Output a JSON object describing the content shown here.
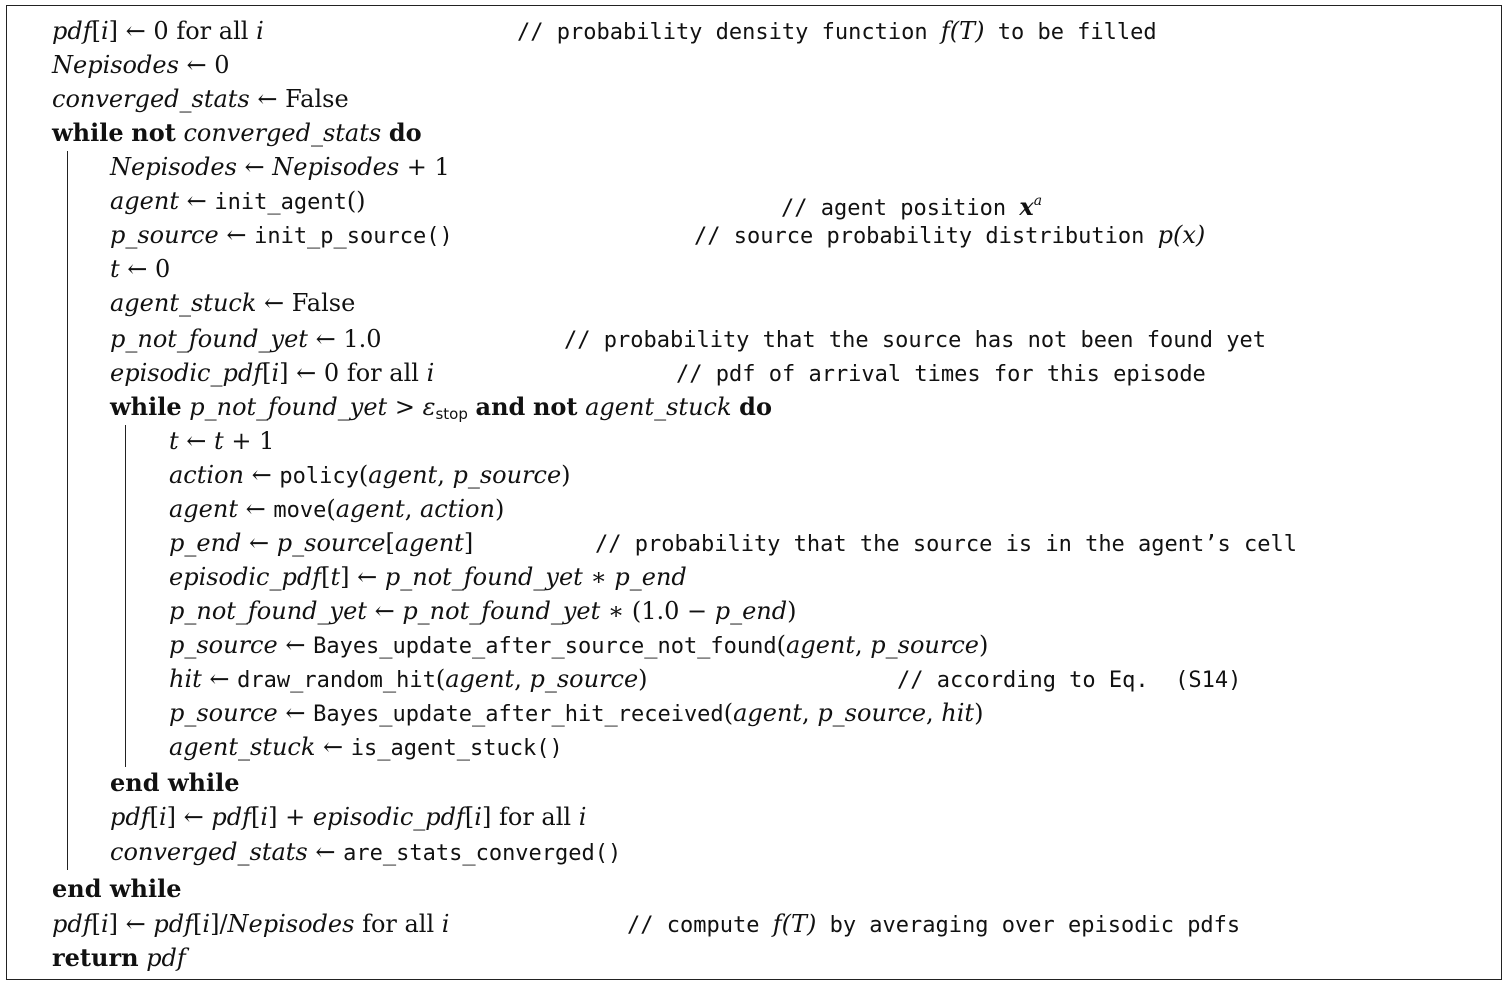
{
  "algorithm": {
    "for_all": "for all",
    "false": "False",
    "kw": {
      "while": "while",
      "not": "not",
      "do": "do",
      "and": "and",
      "end_while": "end while",
      "return": "return"
    },
    "vars": {
      "pdf": "pdf",
      "i": "i",
      "t": "t",
      "nepisodes": "Nepisodes",
      "converged_stats": "converged_stats",
      "agent": "agent",
      "p_source": "p_source",
      "agent_stuck": "agent_stuck",
      "p_not_found_yet": "p_not_found_yet",
      "episodic_pdf": "episodic_pdf",
      "action": "action",
      "p_end": "p_end",
      "hit": "hit",
      "epsilon": "ε",
      "epsilon_sub": "stop"
    },
    "funcs": {
      "init_agent": "init_agent",
      "init_p_source": "init_p_source()",
      "policy": "policy",
      "move": "move",
      "bayes_not_found": "Bayes_update_after_source_not_found",
      "draw_random_hit": "draw_random_hit",
      "bayes_hit": "Bayes_update_after_hit_received",
      "is_agent_stuck": "is_agent_stuck()",
      "are_stats_converged": "are_stats_converged()"
    },
    "values": {
      "zero": "0",
      "one": "1",
      "one_point_zero": "1.0"
    },
    "comments": {
      "c1_pre": "// probability density function ",
      "c1_post": " to be filled",
      "c2": "// agent position ",
      "c3": "// source probability distribution ",
      "c4": "// probability that the source has not been found yet",
      "c5": "// pdf of arrival times for this episode",
      "c6": "// probability that the source is in the agent’s cell",
      "c7": "// according to Eq.  (S14)",
      "c8_pre": "// compute ",
      "c8_post": " by averaging over episodic pdfs"
    },
    "math": {
      "fT": "f(T)",
      "xa_x": "x",
      "xa_a": "a",
      "px": "p(x)"
    }
  }
}
